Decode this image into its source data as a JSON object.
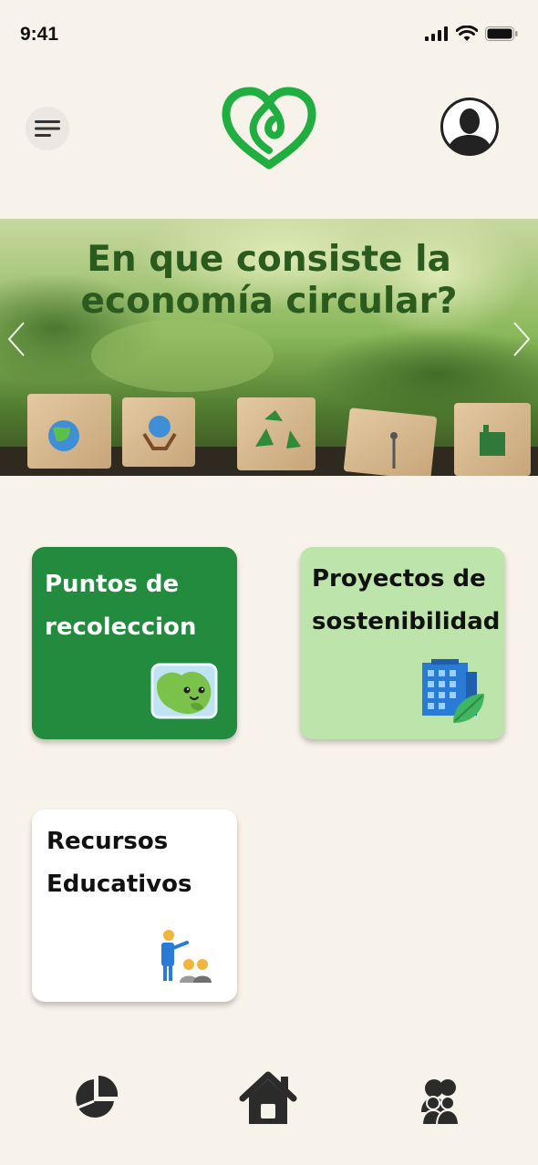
{
  "status": {
    "time": "9:41",
    "icons": [
      "cellular-signal-icon",
      "wifi-icon",
      "battery-icon"
    ]
  },
  "header": {
    "menu_icon": "menu-icon",
    "logo_icon": "heart-leaf-logo",
    "profile_icon": "user-avatar-icon"
  },
  "banner": {
    "title": "En que consiste la economía circular?",
    "prev_icon": "chevron-left-icon",
    "next_icon": "chevron-right-icon"
  },
  "cards": [
    {
      "label": "Puntos de recoleccion",
      "icon": "earth-map-icon",
      "color": "#228b3e"
    },
    {
      "label": "Proyectos de sostenibilidad",
      "icon": "eco-building-icon",
      "color": "#bde4aa"
    },
    {
      "label": "Recursos Educativos",
      "icon": "teacher-students-icon",
      "color": "#ffffff"
    }
  ],
  "bottom_nav": [
    "pie-chart-icon",
    "home-icon",
    "community-icon"
  ],
  "colors": {
    "background": "#f7f2ea",
    "brand_green": "#1fae3f",
    "dark_green_text": "#2b5a1f"
  }
}
